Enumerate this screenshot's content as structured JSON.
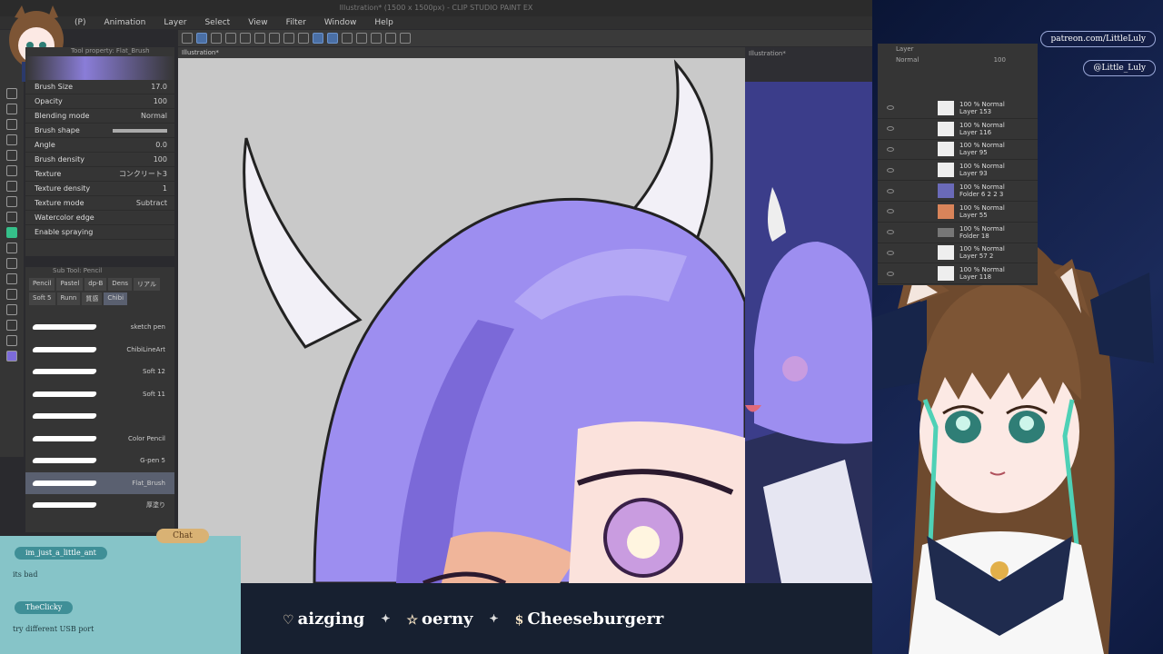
{
  "app": {
    "title": "Illustration* (1500 x 1500px) - CLIP STUDIO PAINT EX",
    "menu": [
      "(P)",
      "Animation",
      "Layer",
      "Select",
      "View",
      "Filter",
      "Window",
      "Help"
    ],
    "canvas_tab": "Illustration*",
    "subview_tab": "Illustration*"
  },
  "tool_property": {
    "header": "Tool property: Flat_Brush",
    "rows": [
      {
        "label": "Brush Size",
        "value": "17.0"
      },
      {
        "label": "Opacity",
        "value": "100"
      },
      {
        "label": "Blending mode",
        "value": "Normal"
      },
      {
        "label": "Brush shape",
        "value": ""
      },
      {
        "label": "Angle",
        "value": "0.0"
      },
      {
        "label": "Brush density",
        "value": "100"
      },
      {
        "label": "Texture",
        "value": "コンクリート3"
      },
      {
        "label": "Texture density",
        "value": "1"
      },
      {
        "label": "Texture mode",
        "value": "Subtract"
      },
      {
        "label": "Watercolor edge",
        "value": ""
      },
      {
        "label": "Enable spraying",
        "value": ""
      }
    ]
  },
  "sub_tool": {
    "header": "Sub Tool: Pencil",
    "tabs": [
      "Pencil",
      "Pastel",
      "dp-B",
      "Dens",
      "リアル",
      "Soft 5",
      "Runn",
      "質感",
      "Chibi"
    ],
    "brushes": [
      {
        "name": "sketch pen",
        "selected": false
      },
      {
        "name": "ChibiLineArt",
        "selected": false
      },
      {
        "name": "Soft 12",
        "selected": false
      },
      {
        "name": "Soft 11",
        "selected": false
      },
      {
        "name": "",
        "selected": false
      },
      {
        "name": "Color Pencil",
        "selected": false
      },
      {
        "name": "G-pen 5",
        "selected": false
      },
      {
        "name": "Flat_Brush",
        "selected": true
      },
      {
        "name": "厚塗り",
        "selected": false
      }
    ]
  },
  "layers": {
    "header": "Layer",
    "blend": "Normal",
    "opacity": "100",
    "items": [
      {
        "mode": "100 % Normal",
        "name": "Layer 153"
      },
      {
        "mode": "100 % Normal",
        "name": "Layer 116"
      },
      {
        "mode": "100 % Normal",
        "name": "Layer 95"
      },
      {
        "mode": "100 % Normal",
        "name": "Layer 93"
      },
      {
        "mode": "100 % Normal",
        "name": "Folder 6 2 2 3"
      },
      {
        "mode": "100 % Normal",
        "name": "Layer 55"
      },
      {
        "mode": "100 % Normal",
        "name": "Folder 18"
      },
      {
        "mode": "100 % Normal",
        "name": "Layer 57 2"
      },
      {
        "mode": "100 % Normal",
        "name": "Layer 118"
      }
    ]
  },
  "stream": {
    "socials": [
      "patreon.com/LittleLuly",
      "@Little_Luly"
    ],
    "chat_badge": "Chat",
    "chat": [
      {
        "user": "im_just_a_little_ant",
        "message": "its bad"
      },
      {
        "user": "TheClicky",
        "message": "try different USB port"
      }
    ],
    "ticker": [
      {
        "icon": "heart-icon",
        "symbol": "♡",
        "name": "aizging"
      },
      {
        "icon": "star-icon",
        "symbol": "☆",
        "name": "oerny"
      },
      {
        "icon": "dollar-icon",
        "symbol": "$",
        "name": "Cheeseburgerr"
      }
    ]
  },
  "colors": {
    "hair": "#9d8ef0",
    "hair_shadow": "#6b55c9",
    "horn": "#f4f2f8",
    "ui_dark": "#353535",
    "chat_bg": "#86c4c8",
    "ticker_bg": "#172030"
  }
}
